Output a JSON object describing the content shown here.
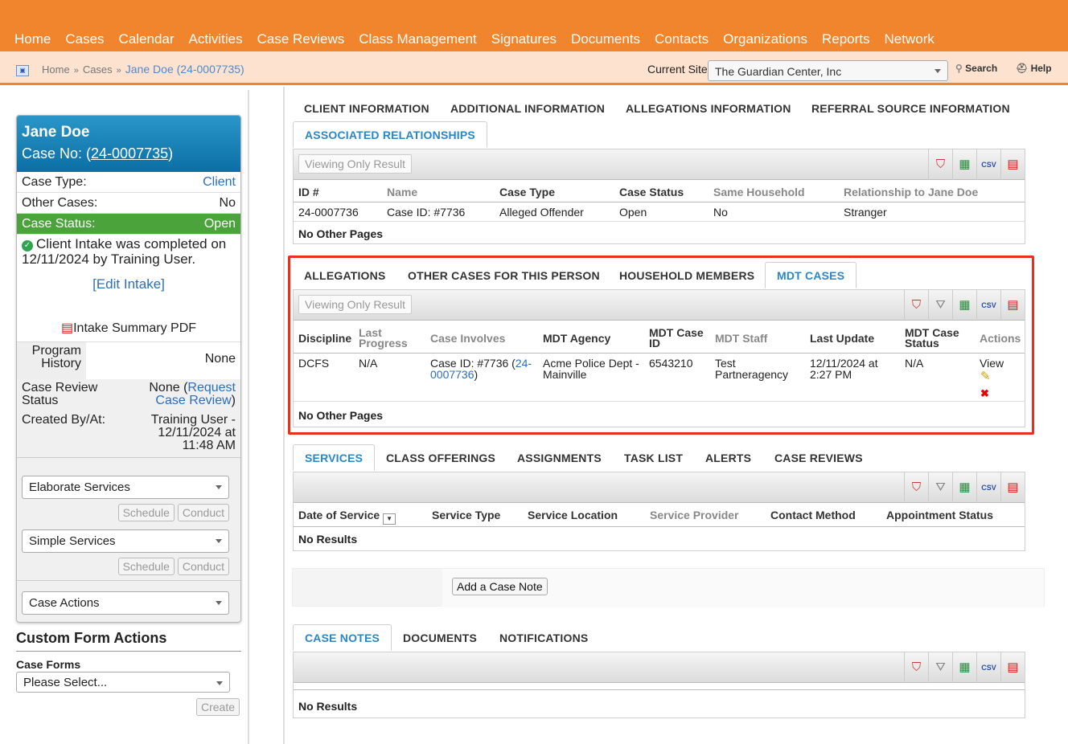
{
  "nav": {
    "items": [
      "Home",
      "Cases",
      "Calendar",
      "Activities",
      "Case Reviews",
      "Class Management",
      "Signatures",
      "Documents",
      "Contacts",
      "Organizations",
      "Reports",
      "Network"
    ]
  },
  "breadcrumb": {
    "home": "Home",
    "sep": "»",
    "cases": "Cases",
    "current": "Jane Doe (24-0007735)"
  },
  "site": {
    "label": "Current Site",
    "value": "The Guardian Center, Inc",
    "search": "Search",
    "help": "Help"
  },
  "case": {
    "name": "Jane Doe",
    "case_no_label": "Case No: (",
    "case_no": "24-0007735",
    "case_no_close": ")",
    "case_type_label": "Case Type:",
    "case_type": "Client",
    "other_cases_label": "Other Cases:",
    "other_cases": "No",
    "status_label": "Case Status:",
    "status": "Open",
    "intake_text": "Client Intake was completed on 12/11/2024 by Training User.",
    "edit_intake": "[Edit Intake]",
    "intake_pdf": "Intake Summary PDF",
    "program_history_label": "Program History",
    "program_history": "None",
    "review_status_label": "Case Review Status",
    "review_status_pre": "None (",
    "review_status_link": "Request Case Review",
    "review_status_post": ")",
    "created_label": "Created By/At:",
    "created": "Training User - 12/11/2024 at 11:48 AM",
    "elaborate": "Elaborate Services",
    "simple": "Simple Services",
    "schedule": "Schedule",
    "conduct": "Conduct",
    "case_actions": "Case Actions"
  },
  "custom_forms": {
    "title": "Custom Form Actions",
    "forms_label": "Case Forms",
    "select": "Please Select...",
    "create": "Create"
  },
  "tabs1": {
    "client": "CLIENT INFORMATION",
    "additional": "ADDITIONAL INFORMATION",
    "allegations_info": "ALLEGATIONS INFORMATION",
    "referral": "REFERRAL SOURCE INFORMATION",
    "assoc": "ASSOCIATED RELATIONSHIPS"
  },
  "assoc": {
    "viewing": "Viewing Only Result",
    "headers": [
      "ID #",
      "Name",
      "Case Type",
      "Case Status",
      "Same Household",
      "Relationship to Jane Doe"
    ],
    "row": [
      "24-0007736",
      "Case ID: #7736",
      "Alleged Offender",
      "Open",
      "No",
      "Stranger"
    ],
    "footer": "No Other Pages"
  },
  "tabs2": {
    "allegations": "ALLEGATIONS",
    "other": "OTHER CASES FOR THIS PERSON",
    "household": "HOUSEHOLD MEMBERS",
    "mdt": "MDT CASES"
  },
  "mdt": {
    "viewing": "Viewing Only Result",
    "h_discipline": "Discipline",
    "h_last1": "Last",
    "h_last2": "Progress",
    "h_involves": "Case Involves",
    "h_agency": "MDT Agency",
    "h_caseid1": "MDT Case",
    "h_caseid2": "ID",
    "h_staff": "MDT Staff",
    "h_update": "Last Update",
    "h_status1": "MDT Case",
    "h_status2": "Status",
    "h_actions": "Actions",
    "discipline": "DCFS",
    "last_progress": "N/A",
    "involves_pre": "Case ID: #7736 (",
    "involves_link1": "24-",
    "involves_link2": "0007736",
    "involves_post": ")",
    "agency1": "Acme Police Dept -",
    "agency2": "Mainville",
    "case_id": "6543210",
    "staff1": "Test",
    "staff2": "Partneragency",
    "update1": "12/11/2024 at",
    "update2": "2:27 PM",
    "status": "N/A",
    "view": "View",
    "footer": "No Other Pages"
  },
  "tabs3": {
    "services": "SERVICES",
    "class": "CLASS OFFERINGS",
    "assignments": "ASSIGNMENTS",
    "task": "TASK LIST",
    "alerts": "ALERTS",
    "reviews": "CASE REVIEWS"
  },
  "services": {
    "headers": [
      "Date of Service",
      "Service Type",
      "Service Location",
      "Service Provider",
      "Contact Method",
      "Appointment Status"
    ],
    "empty": "No Results"
  },
  "add_note": "Add a Case Note",
  "tabs4": {
    "notes": "CASE NOTES",
    "documents": "DOCUMENTS",
    "notifications": "NOTIFICATIONS"
  },
  "notes": {
    "empty": "No Results"
  },
  "icons": {
    "clear": "clear-filter-icon",
    "filter": "filter-icon",
    "excel": "excel-export-icon",
    "csv": "csv-export-icon",
    "pdf": "pdf-export-icon"
  },
  "colors": {
    "brand": "#f0852d",
    "link": "#2a6fb7",
    "header": "#0b6fa5",
    "status": "#4aa43b",
    "highlight": "#e8311d"
  }
}
